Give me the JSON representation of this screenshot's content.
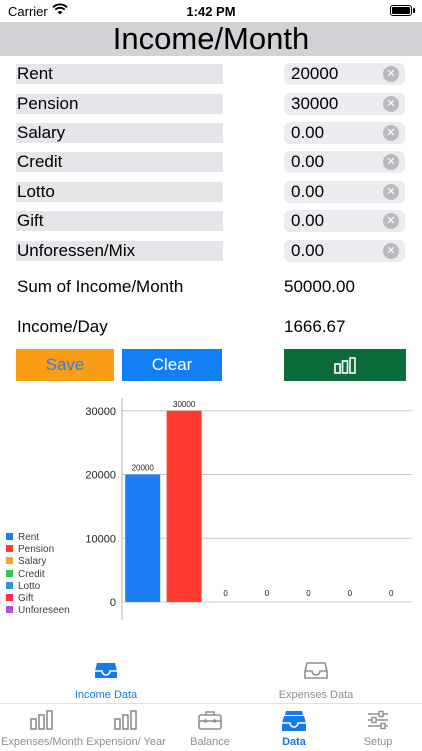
{
  "status": {
    "carrier": "Carrier",
    "time": "1:42 PM"
  },
  "page_title": "Income/Month",
  "income_rows": [
    {
      "label": "Rent",
      "value": "20000"
    },
    {
      "label": "Pension",
      "value": "30000"
    },
    {
      "label": "Salary",
      "value": "0.00"
    },
    {
      "label": "Credit",
      "value": "0.00"
    },
    {
      "label": "Lotto",
      "value": "0.00"
    },
    {
      "label": "Gift",
      "value": "0.00"
    },
    {
      "label": "Unforessen/Mix",
      "value": "0.00"
    }
  ],
  "sum": {
    "label": "Sum of Income/Month",
    "value": "50000.00"
  },
  "per_day": {
    "label": "Income/Day",
    "value": "1666.67"
  },
  "buttons": {
    "save": "Save",
    "clear": "Clear"
  },
  "colors": {
    "accent": "#157ae8",
    "save_bg": "#f99d17",
    "clear_bg": "#137ff5",
    "chart_btn_bg": "#0b6b3a"
  },
  "chart_data": {
    "type": "bar",
    "categories": [
      "Rent",
      "Pension",
      "Salary",
      "Credit",
      "Lotto",
      "Gift",
      "Unforeseen"
    ],
    "values": [
      20000,
      30000,
      0,
      0,
      0,
      0,
      0
    ],
    "data_labels": [
      "20000",
      "30000",
      "0",
      "0",
      "0",
      "0",
      "0"
    ],
    "colors": [
      "#1a7ef2",
      "#ff3b30",
      "#f2a530",
      "#34c759",
      "#2a96d8",
      "#ff2d55",
      "#af52de"
    ],
    "ylim": [
      0,
      32000
    ],
    "yticks": [
      0,
      10000,
      20000,
      30000
    ],
    "grid": true,
    "legend": "left"
  },
  "data_tabs": {
    "income": "Income Data",
    "expenses": "Expenses Data"
  },
  "tabbar": [
    {
      "label": "Expenses/Month",
      "icon": "bar-chart-icon"
    },
    {
      "label": "Expension/ Year",
      "icon": "bar-chart-icon"
    },
    {
      "label": "Balance",
      "icon": "briefcase-icon"
    },
    {
      "label": "Data",
      "icon": "tray-icon"
    },
    {
      "label": "Setup",
      "icon": "sliders-icon"
    }
  ]
}
